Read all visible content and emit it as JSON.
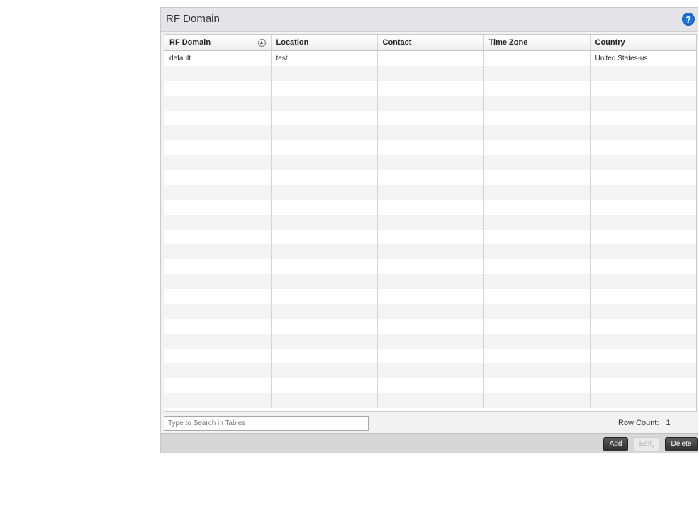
{
  "panel": {
    "title": "RF Domain",
    "help_icon": "question-icon"
  },
  "table": {
    "columns": [
      "RF Domain",
      "Location",
      "Contact",
      "Time Zone",
      "Country"
    ],
    "sort_icon": "sort-ascending-icon",
    "rows": [
      [
        "default",
        "test",
        "",
        "",
        "United States-us"
      ]
    ]
  },
  "search": {
    "placeholder": "Type to Search in Tables"
  },
  "row_count": {
    "label": "Row Count:",
    "value": "1"
  },
  "buttons": {
    "add": "Add",
    "edit": "Edit",
    "delete": "Delete"
  }
}
